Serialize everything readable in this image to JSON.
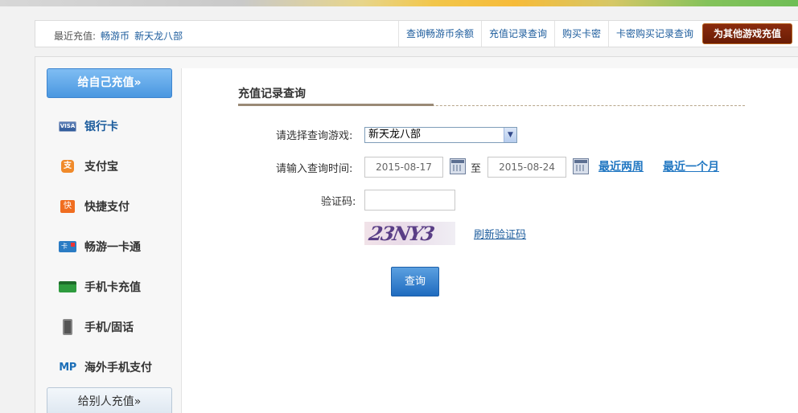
{
  "top_bar": {
    "recent_label": "最近充值:",
    "recent_links": [
      "畅游币",
      "新天龙八部"
    ],
    "links": [
      "查询畅游币余额",
      "充值记录查询",
      "购买卡密",
      "卡密购买记录查询"
    ],
    "other_game_button": "为其他游戏充值"
  },
  "sidebar": {
    "self_recharge_button": "给自己充值»",
    "others_recharge_button": "给别人充值»",
    "items": [
      {
        "label": "银行卡",
        "icon": "visa-card-icon",
        "icon_text": "VISA",
        "active": true
      },
      {
        "label": "支付宝",
        "icon": "alipay-icon",
        "icon_text": "支"
      },
      {
        "label": "快捷支付",
        "icon": "quick-pay-icon",
        "icon_text": "快"
      },
      {
        "label": "畅游一卡通",
        "icon": "changyou-card-icon",
        "icon_text": "卡"
      },
      {
        "label": "手机卡充值",
        "icon": "phone-card-icon",
        "icon_text": ""
      },
      {
        "label": "手机/固话",
        "icon": "mobile-phone-icon",
        "icon_text": ""
      },
      {
        "label": "海外手机支付",
        "icon": "mp-icon",
        "icon_text": "MP"
      }
    ]
  },
  "main": {
    "title": "充值记录查询",
    "game_label": "请选择查询游戏:",
    "game_selected": "新天龙八部",
    "time_label": "请输入查询时间:",
    "start_date": "2015-08-17",
    "to_label": "至",
    "end_date": "2015-08-24",
    "quick_ranges": [
      "最近两周",
      "最近一个月"
    ],
    "captcha_label": "验证码:",
    "captcha_value": "",
    "captcha_image_text": "23NY3",
    "refresh_captcha": "刷新验证码",
    "query_button": "查询"
  }
}
